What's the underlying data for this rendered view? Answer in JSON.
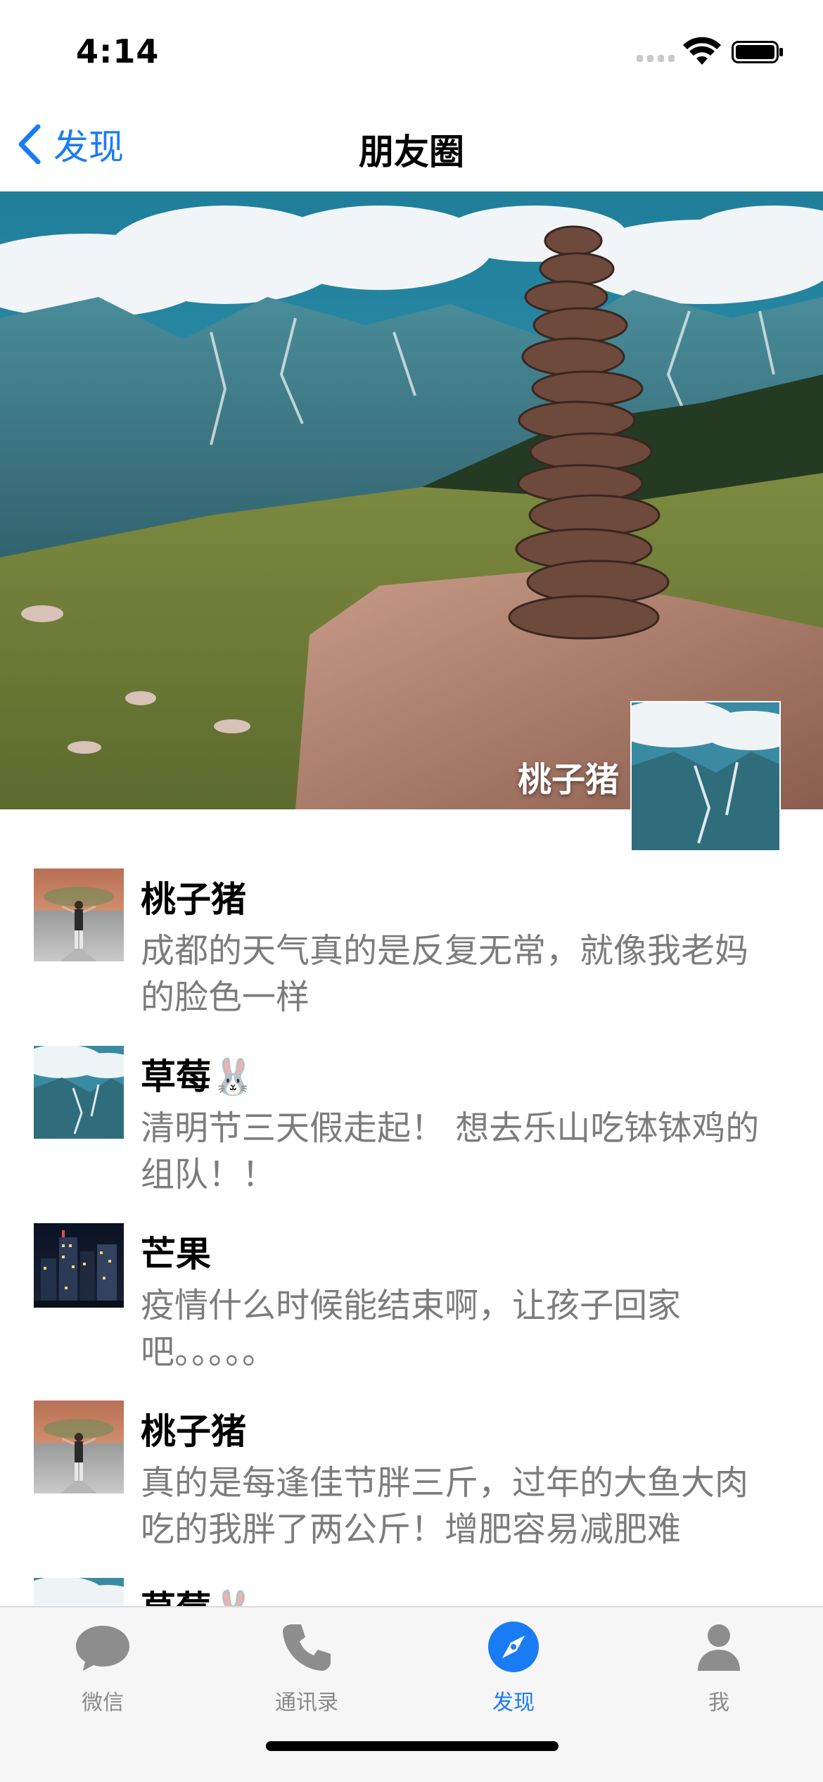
{
  "status_bar": {
    "time": "4:14"
  },
  "nav": {
    "back_label": "发现",
    "title": "朋友圈"
  },
  "cover": {
    "user_name": "桃子猪"
  },
  "posts": [
    {
      "name": "桃子猪",
      "text": "成都的天气真的是反复无常，就像我老妈的脸色一样",
      "avatar": "person-on-road-avatar"
    },
    {
      "name": "草莓🐰",
      "text": "清明节三天假走起！ 想去乐山吃钵钵鸡的组队！！",
      "avatar": "mountain-avatar"
    },
    {
      "name": "芒果",
      "text": "疫情什么时候能结束啊，让孩子回家吧。。。。。",
      "avatar": "city-night-avatar"
    },
    {
      "name": "桃子猪",
      "text": "真的是每逢佳节胖三斤，过年的大鱼大肉吃的我胖了两公斤！增肥容易减肥难",
      "avatar": "person-on-road-avatar"
    },
    {
      "name": "草莓🐰",
      "text": "",
      "avatar": "mountain-avatar"
    }
  ],
  "tab_bar": {
    "tabs": [
      {
        "label": "微信",
        "icon": "chat-bubble-icon"
      },
      {
        "label": "通讯录",
        "icon": "phone-icon"
      },
      {
        "label": "发现",
        "icon": "compass-icon",
        "active": true
      },
      {
        "label": "我",
        "icon": "person-icon"
      }
    ]
  },
  "colors": {
    "accent": "#1a7cf5",
    "secondary_text": "#7c7c7c",
    "tab_inactive": "#8a8a8a"
  }
}
